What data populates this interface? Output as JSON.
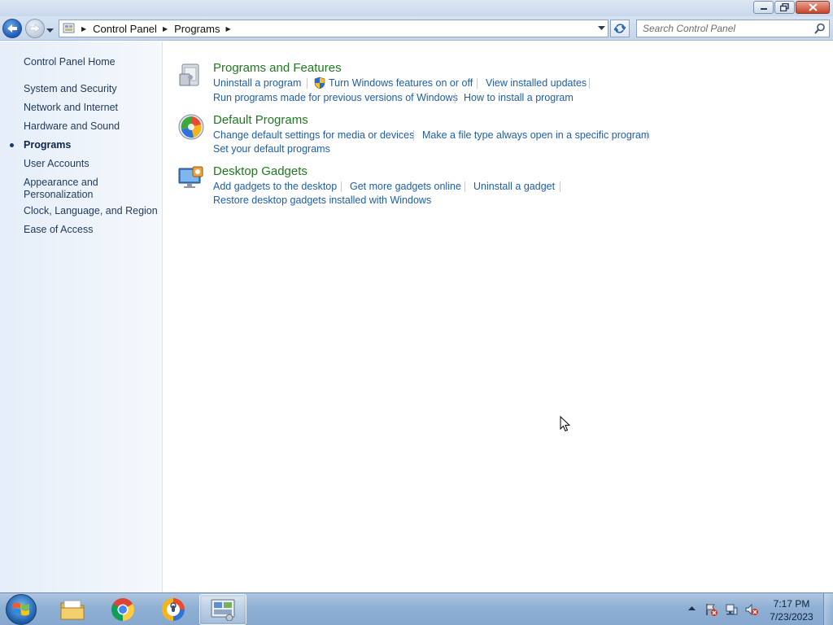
{
  "window": {
    "minimize_icon": "minimize-icon",
    "maximize_icon": "restore-icon",
    "close_icon": "close-icon"
  },
  "navbar": {
    "breadcrumb": [
      "Control Panel",
      "Programs"
    ],
    "search_placeholder": "Search Control Panel"
  },
  "sidebar": {
    "items": [
      {
        "label": "Control Panel Home",
        "active": false
      },
      {
        "label": "System and Security",
        "active": false
      },
      {
        "label": "Network and Internet",
        "active": false
      },
      {
        "label": "Hardware and Sound",
        "active": false
      },
      {
        "label": "Programs",
        "active": true
      },
      {
        "label": "User Accounts",
        "active": false
      },
      {
        "label": "Appearance and Personalization",
        "active": false
      },
      {
        "label": "Clock, Language, and Region",
        "active": false
      },
      {
        "label": "Ease of Access",
        "active": false
      }
    ]
  },
  "categories": [
    {
      "title": "Programs and Features",
      "icon": "programs-features-icon",
      "tasks": [
        "Uninstall a program",
        "Turn Windows features on or off",
        "View installed updates",
        "Run programs made for previous versions of Windows",
        "How to install a program"
      ]
    },
    {
      "title": "Default Programs",
      "icon": "default-programs-icon",
      "tasks": [
        "Change default settings for media or devices",
        "Make a file type always open in a specific program",
        "Set your default programs"
      ]
    },
    {
      "title": "Desktop Gadgets",
      "icon": "desktop-gadgets-icon",
      "tasks": [
        "Add gadgets to the desktop",
        "Get more gadgets online",
        "Uninstall a gadget",
        "Restore desktop gadgets installed with Windows"
      ]
    }
  ],
  "taskbar": {
    "apps": [
      "file-explorer-icon",
      "chrome-icon",
      "app-icon",
      "control-panel-icon"
    ],
    "clock_time": "7:17 PM",
    "clock_date": "7/23/2023"
  }
}
